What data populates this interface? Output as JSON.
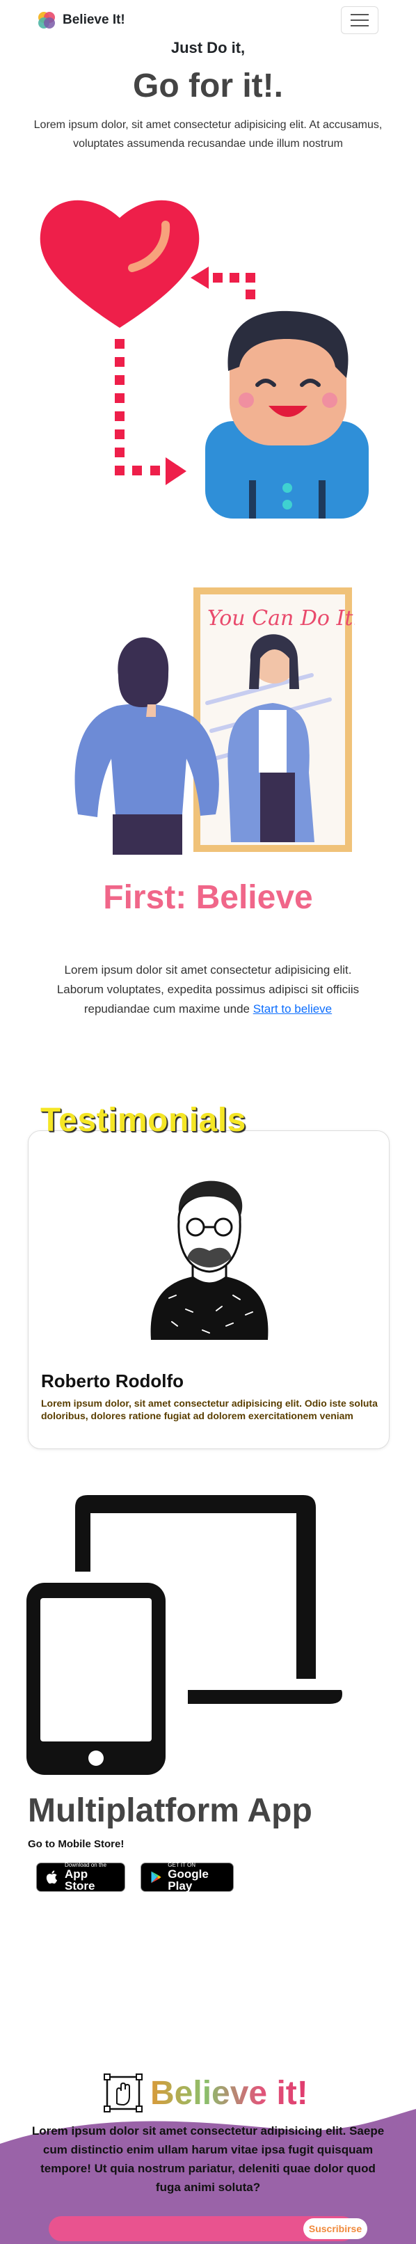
{
  "nav": {
    "brand": "Believe It!",
    "menu_icon": "hamburger-icon"
  },
  "hero": {
    "subtitle": "Just Do it,",
    "title": "Go for it!.",
    "text": "Lorem ipsum dolor, sit amet consectetur adipisicing elit. At accusamus, voluptates assumenda recusandae unde illum nostrum"
  },
  "believe": {
    "mirror_text": "You Can Do It!",
    "title": "First: Believe",
    "text": "Lorem ipsum dolor sit amet consectetur adipisicing elit. Laborum voluptates, expedita possimus adipisci sit officiis repudiandae cum maxime unde ",
    "link": "Start to believe"
  },
  "testimonials": {
    "title": "Testimonials",
    "name": "Roberto Rodolfo",
    "quote": "Lorem ipsum dolor, sit amet consectetur adipisicing elit. Odio iste soluta doloribus, dolores ratione fugiat ad dolorem exercitationem veniam"
  },
  "multiplatform": {
    "title": "Multiplatform App",
    "subtitle": "Go to Mobile Store!",
    "apple_small": "Download on the",
    "apple_big": "App Store",
    "google_small": "GET IT ON",
    "google_big": "Google Play"
  },
  "footer": {
    "brand": "Believe it!",
    "text": "Lorem ipsum dolor sit amet consectetur adipisicing elit. Saepe cum distinctio enim ullam harum vitae ipsa fugit quisquam tempore! Ut quia nostrum pariatur, deleniti quae dolor quod fuga animi soluta?",
    "subscribe_label": "Suscribirse"
  },
  "colors": {
    "accent_pink": "#f06689",
    "testimonial_yellow": "#f5e625",
    "footer_purple": "#9a63a8",
    "subscribe_pink": "#e9538f"
  }
}
